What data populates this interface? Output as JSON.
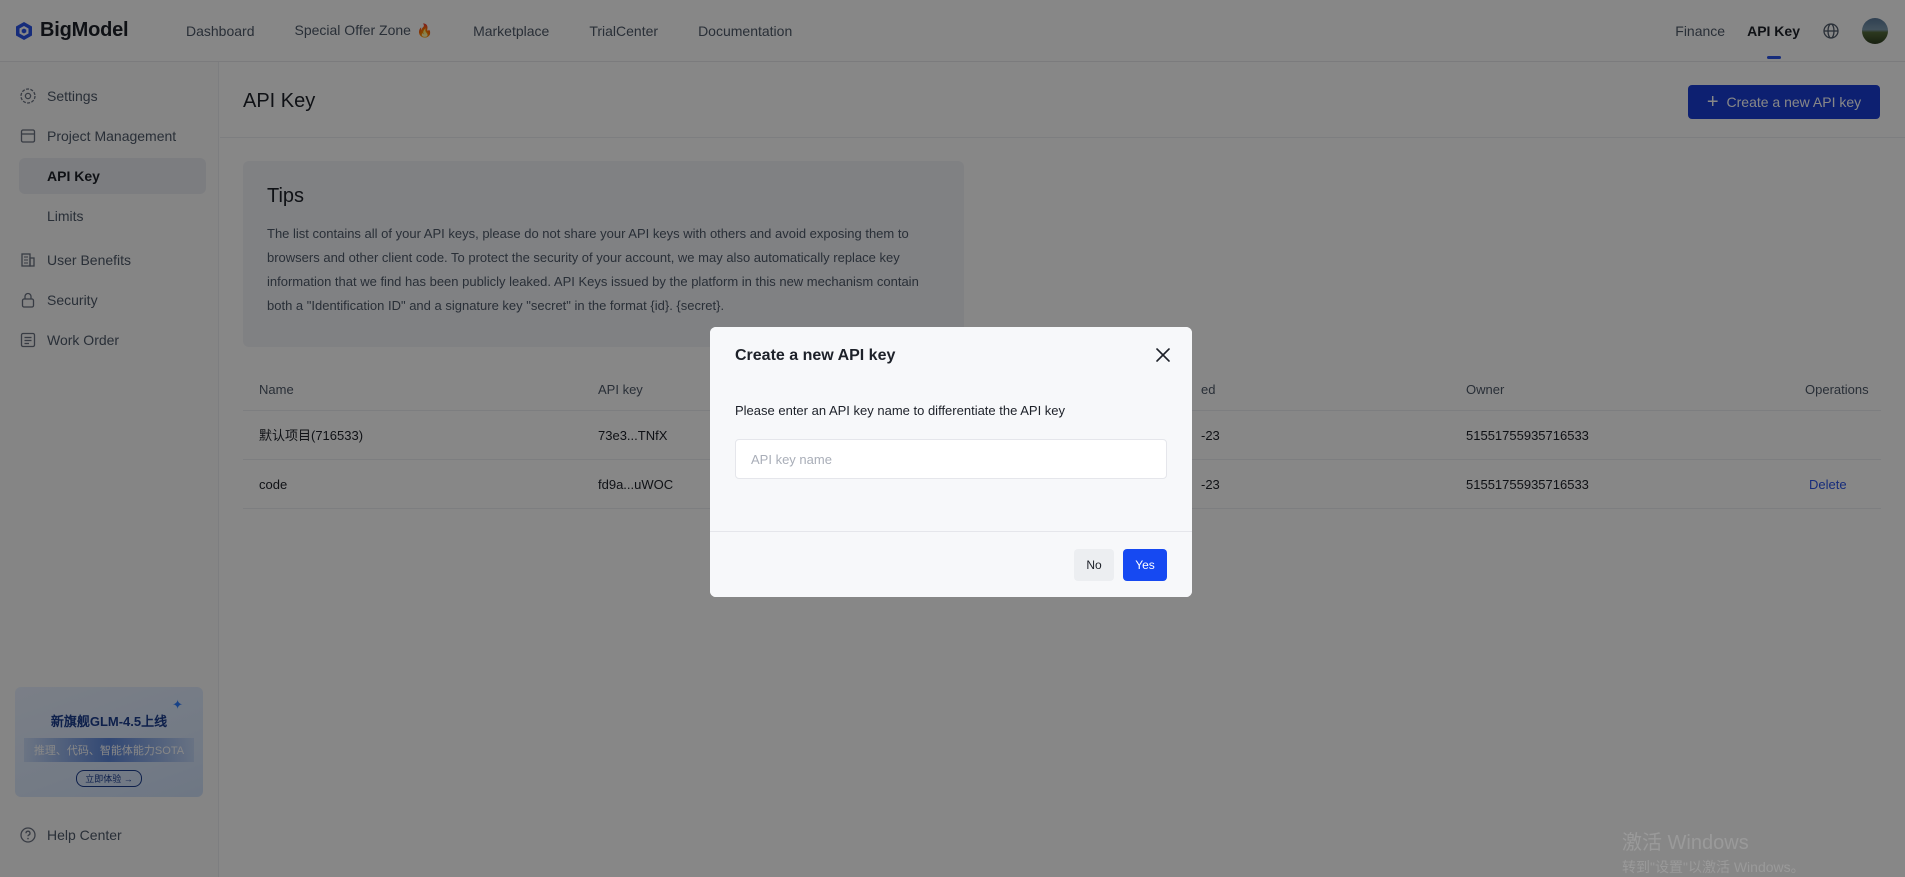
{
  "brand": {
    "name": "BigModel"
  },
  "topnav": {
    "items": [
      {
        "label": "Dashboard"
      },
      {
        "label": "Special Offer Zone",
        "badge": "🔥"
      },
      {
        "label": "Marketplace"
      },
      {
        "label": "TrialCenter"
      },
      {
        "label": "Documentation"
      }
    ],
    "right": {
      "finance": "Finance",
      "api_key": "API Key"
    }
  },
  "sidebar": {
    "items": [
      {
        "label": "Settings",
        "icon": "gear-icon"
      },
      {
        "label": "Project Management",
        "icon": "folder-icon"
      },
      {
        "label": "API Key",
        "active": true
      },
      {
        "label": "Limits"
      },
      {
        "label": "User Benefits",
        "icon": "building-icon"
      },
      {
        "label": "Security",
        "icon": "lock-icon"
      },
      {
        "label": "Work Order",
        "icon": "list-icon"
      }
    ],
    "promo": {
      "title": "新旗舰GLM-4.5上线",
      "subtitle": "推理、代码、智能体能力SOTA",
      "cta": "立即体验 →"
    },
    "help": "Help Center"
  },
  "main": {
    "title": "API Key",
    "create_button": "Create a new API key",
    "tips": {
      "title": "Tips",
      "body": "The list contains all of your API keys, please do not share your API keys with others and avoid exposing them to browsers and other client code. To protect the security of your account, we may also automatically replace key information that we find has been publicly leaked. API Keys issued by the platform in this new mechanism contain both a \"Identification ID\" and a signature key \"secret\" in the format {id}. {secret}."
    },
    "table": {
      "columns": [
        "Name",
        "API key",
        "ed",
        "Owner",
        "Operations"
      ],
      "rows": [
        {
          "name": "默认项目(716533)",
          "key": "73e3...TNfX",
          "created": "-23",
          "owner": "51551755935716533",
          "operation": ""
        },
        {
          "name": "code",
          "key": "fd9a...uWOC",
          "created": "-23",
          "owner": "51551755935716533",
          "operation": "Delete"
        }
      ]
    }
  },
  "watermark": {
    "line1": "激活 Windows",
    "line2": "转到\"设置\"以激活 Windows。"
  },
  "modal": {
    "title": "Create a new API key",
    "description": "Please enter an API key name to differentiate the API key",
    "input_placeholder": "API key name",
    "input_value": "",
    "no_label": "No",
    "yes_label": "Yes"
  },
  "colors": {
    "primary": "#1a3dd6",
    "link": "#2b54e8",
    "yes": "#1649f2"
  }
}
